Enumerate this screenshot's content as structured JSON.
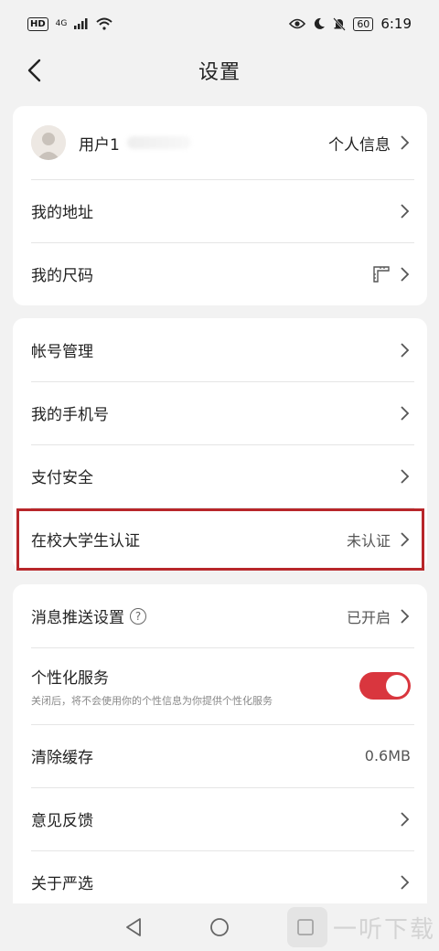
{
  "status_bar": {
    "hd": "HD",
    "network": "4G",
    "battery": "60",
    "time": "6:19"
  },
  "header": {
    "title": "设置"
  },
  "profile": {
    "name": "用户1",
    "link": "个人信息"
  },
  "group1": [
    {
      "label": "我的地址"
    },
    {
      "label": "我的尺码"
    }
  ],
  "group2": [
    {
      "label": "帐号管理"
    },
    {
      "label": "我的手机号"
    },
    {
      "label": "支付安全"
    },
    {
      "label": "在校大学生认证",
      "value": "未认证"
    }
  ],
  "group3": {
    "push": {
      "label": "消息推送设置",
      "help": "?",
      "value": "已开启"
    },
    "personal": {
      "label": "个性化服务",
      "sub": "关闭后，将不会使用你的个性信息为你提供个性化服务",
      "enabled": true
    },
    "cache": {
      "label": "清除缓存",
      "value": "0.6MB"
    },
    "feedback": {
      "label": "意见反馈"
    },
    "about": {
      "label": "关于严选"
    }
  },
  "watermark": {
    "text": "一听下载"
  },
  "colors": {
    "accent": "#d9363e",
    "highlight": "#b8262a",
    "background": "#f2f2f2"
  }
}
